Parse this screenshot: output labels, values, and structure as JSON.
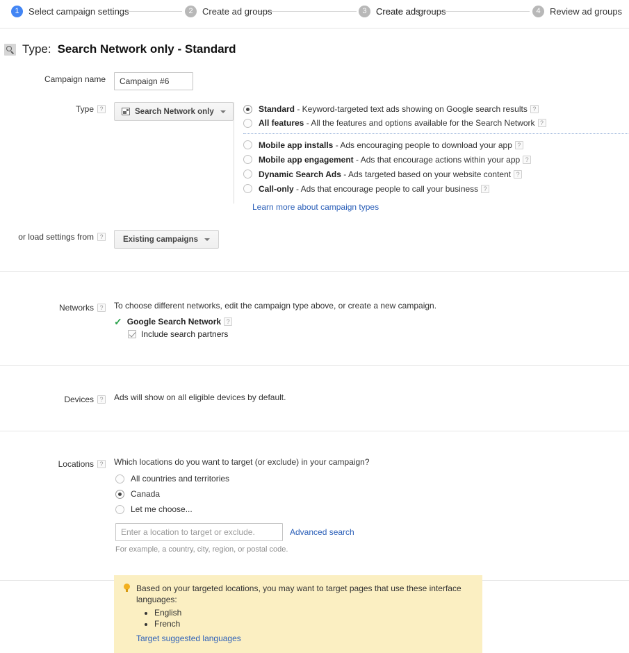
{
  "stepper": {
    "steps": [
      {
        "num": "1",
        "label": "Select campaign settings",
        "state": "active"
      },
      {
        "num": "2",
        "label": "Create ad groups",
        "state": "inactive"
      },
      {
        "num": "3",
        "label": "Create ads",
        "state": "inactive"
      },
      {
        "num": "4",
        "label": "Review ad groups",
        "state": "inactive"
      }
    ]
  },
  "type_header": {
    "icon": "search-icon",
    "label": "Type:",
    "value": "Search Network only - Standard"
  },
  "campaign_name": {
    "label": "Campaign name",
    "value": "Campaign #6"
  },
  "type_section": {
    "label": "Type",
    "help": "?",
    "dropdown_label": "Search Network only",
    "options": [
      {
        "name": "Standard",
        "desc": " - Keyword-targeted text ads showing on Google search results",
        "selected": true,
        "help": "?"
      },
      {
        "name": "All features",
        "desc": " - All the features and options available for the Search Network",
        "selected": false,
        "help": "?"
      },
      {
        "name": "Mobile app installs",
        "desc": " - Ads encouraging people to download your app",
        "selected": false,
        "help": "?"
      },
      {
        "name": "Mobile app engagement",
        "desc": " - Ads that encourage actions within your app",
        "selected": false,
        "help": "?"
      },
      {
        "name": "Dynamic Search Ads",
        "desc": " - Ads targeted based on your website content",
        "selected": false,
        "help": "?"
      },
      {
        "name": "Call-only",
        "desc": " - Ads that encourage people to call your business",
        "selected": false,
        "help": "?"
      }
    ],
    "learn_more": "Learn more about campaign types"
  },
  "load_settings": {
    "label": "or load settings from",
    "help": "?",
    "dropdown_label": "Existing campaigns"
  },
  "networks": {
    "label": "Networks",
    "help": "?",
    "description": "To choose different networks, edit the campaign type above, or create a new campaign.",
    "google_search_network": "Google Search Network",
    "google_search_network_help": "?",
    "include_search_partners": "Include search partners"
  },
  "devices": {
    "label": "Devices",
    "help": "?",
    "description": "Ads will show on all eligible devices by default."
  },
  "locations": {
    "label": "Locations",
    "help": "?",
    "question": "Which locations do you want to target (or exclude) in your campaign?",
    "options": [
      {
        "label": "All countries and territories",
        "selected": false
      },
      {
        "label": "Canada",
        "selected": true
      },
      {
        "label": "Let me choose...",
        "selected": false
      }
    ],
    "input_placeholder": "Enter a location to target or exclude.",
    "input_value": "",
    "advanced_search": "Advanced search",
    "example_hint": "For example, a country, city, region, or postal code."
  },
  "notice": {
    "icon": "lightbulb-icon",
    "text": "Based on your targeted locations, you may want to target pages that use these interface languages:",
    "languages": [
      "English",
      "French"
    ],
    "link": "Target suggested languages"
  },
  "colors": {
    "accent": "#4285f4",
    "link": "#2b5fb8",
    "notice_bg": "#fbefc2",
    "check_green": "#2aa14c"
  }
}
